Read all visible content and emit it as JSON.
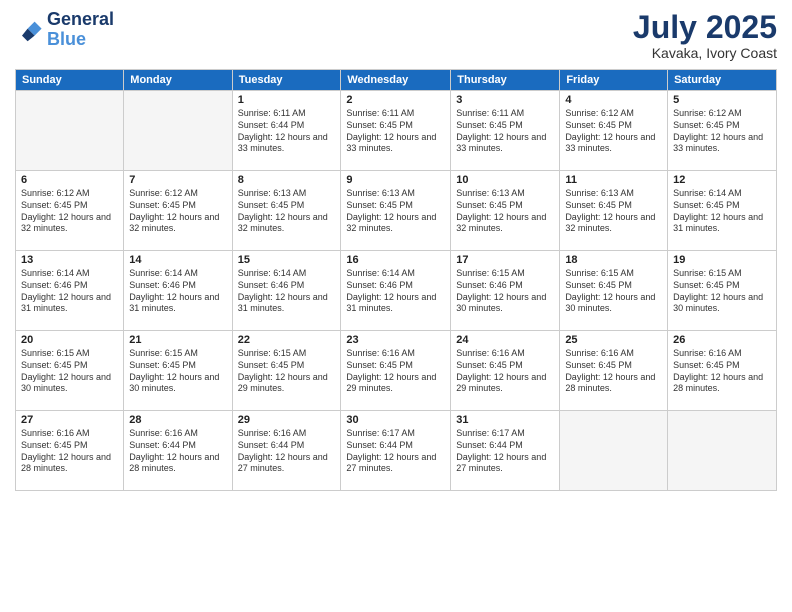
{
  "header": {
    "logo_line1": "General",
    "logo_line2": "Blue",
    "month": "July 2025",
    "location": "Kavaka, Ivory Coast"
  },
  "days_of_week": [
    "Sunday",
    "Monday",
    "Tuesday",
    "Wednesday",
    "Thursday",
    "Friday",
    "Saturday"
  ],
  "weeks": [
    [
      {
        "day": "",
        "empty": true
      },
      {
        "day": "",
        "empty": true
      },
      {
        "day": "1",
        "sunrise": "6:11 AM",
        "sunset": "6:44 PM",
        "daylight": "12 hours and 33 minutes."
      },
      {
        "day": "2",
        "sunrise": "6:11 AM",
        "sunset": "6:45 PM",
        "daylight": "12 hours and 33 minutes."
      },
      {
        "day": "3",
        "sunrise": "6:11 AM",
        "sunset": "6:45 PM",
        "daylight": "12 hours and 33 minutes."
      },
      {
        "day": "4",
        "sunrise": "6:12 AM",
        "sunset": "6:45 PM",
        "daylight": "12 hours and 33 minutes."
      },
      {
        "day": "5",
        "sunrise": "6:12 AM",
        "sunset": "6:45 PM",
        "daylight": "12 hours and 33 minutes."
      }
    ],
    [
      {
        "day": "6",
        "sunrise": "6:12 AM",
        "sunset": "6:45 PM",
        "daylight": "12 hours and 32 minutes."
      },
      {
        "day": "7",
        "sunrise": "6:12 AM",
        "sunset": "6:45 PM",
        "daylight": "12 hours and 32 minutes."
      },
      {
        "day": "8",
        "sunrise": "6:13 AM",
        "sunset": "6:45 PM",
        "daylight": "12 hours and 32 minutes."
      },
      {
        "day": "9",
        "sunrise": "6:13 AM",
        "sunset": "6:45 PM",
        "daylight": "12 hours and 32 minutes."
      },
      {
        "day": "10",
        "sunrise": "6:13 AM",
        "sunset": "6:45 PM",
        "daylight": "12 hours and 32 minutes."
      },
      {
        "day": "11",
        "sunrise": "6:13 AM",
        "sunset": "6:45 PM",
        "daylight": "12 hours and 32 minutes."
      },
      {
        "day": "12",
        "sunrise": "6:14 AM",
        "sunset": "6:45 PM",
        "daylight": "12 hours and 31 minutes."
      }
    ],
    [
      {
        "day": "13",
        "sunrise": "6:14 AM",
        "sunset": "6:46 PM",
        "daylight": "12 hours and 31 minutes."
      },
      {
        "day": "14",
        "sunrise": "6:14 AM",
        "sunset": "6:46 PM",
        "daylight": "12 hours and 31 minutes."
      },
      {
        "day": "15",
        "sunrise": "6:14 AM",
        "sunset": "6:46 PM",
        "daylight": "12 hours and 31 minutes."
      },
      {
        "day": "16",
        "sunrise": "6:14 AM",
        "sunset": "6:46 PM",
        "daylight": "12 hours and 31 minutes."
      },
      {
        "day": "17",
        "sunrise": "6:15 AM",
        "sunset": "6:46 PM",
        "daylight": "12 hours and 30 minutes."
      },
      {
        "day": "18",
        "sunrise": "6:15 AM",
        "sunset": "6:45 PM",
        "daylight": "12 hours and 30 minutes."
      },
      {
        "day": "19",
        "sunrise": "6:15 AM",
        "sunset": "6:45 PM",
        "daylight": "12 hours and 30 minutes."
      }
    ],
    [
      {
        "day": "20",
        "sunrise": "6:15 AM",
        "sunset": "6:45 PM",
        "daylight": "12 hours and 30 minutes."
      },
      {
        "day": "21",
        "sunrise": "6:15 AM",
        "sunset": "6:45 PM",
        "daylight": "12 hours and 30 minutes."
      },
      {
        "day": "22",
        "sunrise": "6:15 AM",
        "sunset": "6:45 PM",
        "daylight": "12 hours and 29 minutes."
      },
      {
        "day": "23",
        "sunrise": "6:16 AM",
        "sunset": "6:45 PM",
        "daylight": "12 hours and 29 minutes."
      },
      {
        "day": "24",
        "sunrise": "6:16 AM",
        "sunset": "6:45 PM",
        "daylight": "12 hours and 29 minutes."
      },
      {
        "day": "25",
        "sunrise": "6:16 AM",
        "sunset": "6:45 PM",
        "daylight": "12 hours and 28 minutes."
      },
      {
        "day": "26",
        "sunrise": "6:16 AM",
        "sunset": "6:45 PM",
        "daylight": "12 hours and 28 minutes."
      }
    ],
    [
      {
        "day": "27",
        "sunrise": "6:16 AM",
        "sunset": "6:45 PM",
        "daylight": "12 hours and 28 minutes."
      },
      {
        "day": "28",
        "sunrise": "6:16 AM",
        "sunset": "6:44 PM",
        "daylight": "12 hours and 28 minutes."
      },
      {
        "day": "29",
        "sunrise": "6:16 AM",
        "sunset": "6:44 PM",
        "daylight": "12 hours and 27 minutes."
      },
      {
        "day": "30",
        "sunrise": "6:17 AM",
        "sunset": "6:44 PM",
        "daylight": "12 hours and 27 minutes."
      },
      {
        "day": "31",
        "sunrise": "6:17 AM",
        "sunset": "6:44 PM",
        "daylight": "12 hours and 27 minutes."
      },
      {
        "day": "",
        "empty": true
      },
      {
        "day": "",
        "empty": true
      }
    ]
  ],
  "labels": {
    "sunrise_prefix": "Sunrise: ",
    "sunset_prefix": "Sunset: ",
    "daylight_prefix": "Daylight: "
  }
}
